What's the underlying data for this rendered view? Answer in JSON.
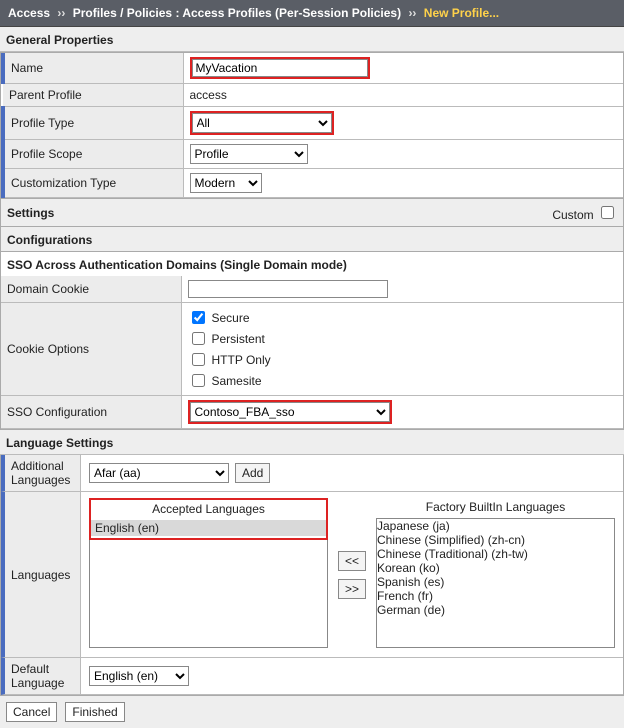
{
  "breadcrumb": {
    "root": "Access",
    "section": "Profiles / Policies : Access Profiles (Per-Session Policies)",
    "current": "New Profile..."
  },
  "section_titles": {
    "general": "General Properties",
    "settings": "Settings",
    "custom_label": "Custom",
    "configurations": "Configurations",
    "sso": "SSO Across Authentication Domains (Single Domain mode)",
    "language": "Language Settings"
  },
  "general": {
    "name_label": "Name",
    "name_value": "MyVacation",
    "parent_label": "Parent Profile",
    "parent_value": "access",
    "profile_type_label": "Profile Type",
    "profile_type_value": "All",
    "profile_scope_label": "Profile Scope",
    "profile_scope_value": "Profile",
    "cust_type_label": "Customization Type",
    "cust_type_value": "Modern"
  },
  "sso": {
    "domain_cookie_label": "Domain Cookie",
    "domain_cookie_value": "",
    "cookie_options_label": "Cookie Options",
    "opts": {
      "secure": "Secure",
      "persistent": "Persistent",
      "httponly": "HTTP Only",
      "samesite": "Samesite"
    },
    "opts_checked": {
      "secure": true,
      "persistent": false,
      "httponly": false,
      "samesite": false
    },
    "sso_config_label": "SSO Configuration",
    "sso_config_value": "Contoso_FBA_sso"
  },
  "language": {
    "additional_label": "Additional Languages",
    "additional_value": "Afar (aa)",
    "add_btn": "Add",
    "languages_label": "Languages",
    "accepted_title": "Accepted Languages",
    "factory_title": "Factory BuiltIn Languages",
    "accepted_items": [
      "English (en)"
    ],
    "factory_items": [
      "Japanese (ja)",
      "Chinese (Simplified) (zh-cn)",
      "Chinese (Traditional) (zh-tw)",
      "Korean (ko)",
      "Spanish (es)",
      "French (fr)",
      "German (de)"
    ],
    "move_left": "<<",
    "move_right": ">>",
    "default_label": "Default Language",
    "default_value": "English (en)"
  },
  "footer": {
    "cancel": "Cancel",
    "finished": "Finished"
  }
}
